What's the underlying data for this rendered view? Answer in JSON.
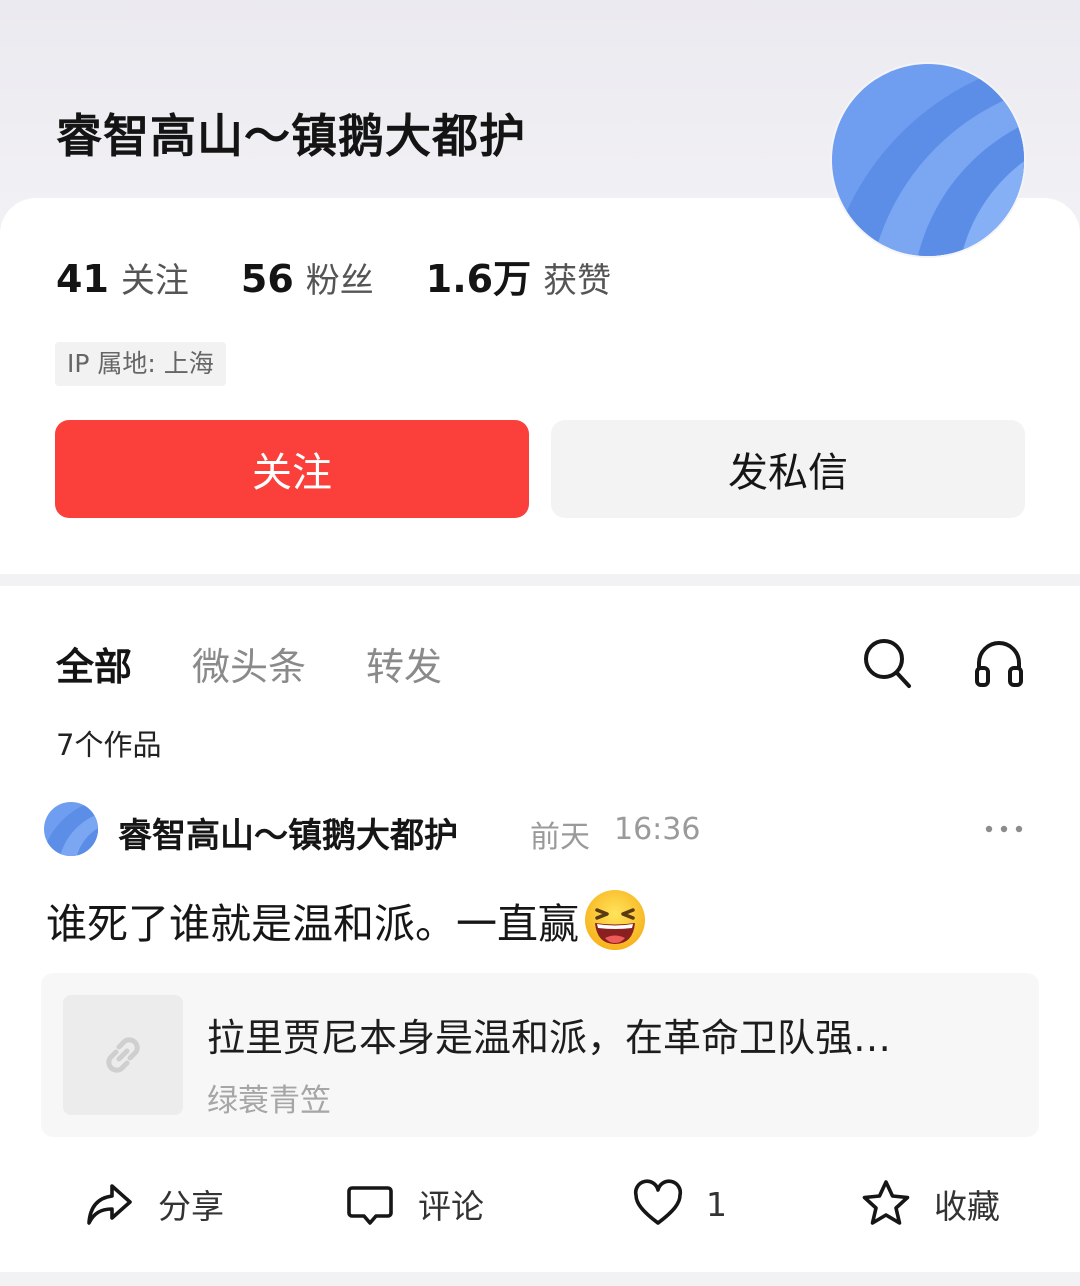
{
  "profile": {
    "name": "睿智高山～镇鹅大都护",
    "stats": [
      {
        "value": "41",
        "label": "关注"
      },
      {
        "value": "56",
        "label": "粉丝"
      },
      {
        "value": "1.6万",
        "label": "获赞"
      }
    ],
    "ip_location": "IP 属地: 上海",
    "follow_button": "关注",
    "message_button": "发私信"
  },
  "tabs": {
    "items": [
      {
        "label": "全部",
        "active": true
      },
      {
        "label": "微头条",
        "active": false
      },
      {
        "label": "转发",
        "active": false
      }
    ],
    "search_icon": "search-icon",
    "headphones_icon": "headphones-icon"
  },
  "works_count": "7个作品",
  "post": {
    "author": "睿智高山～镇鹅大都护",
    "date": "前天",
    "time": "16:36",
    "text": "谁死了谁就是温和派。一直赢",
    "emoji": "laughing-emoji",
    "link": {
      "title": "拉里贾尼本身是温和派，在革命卫队强…",
      "source": "绿蓑青笠",
      "icon": "link-icon"
    },
    "actions": {
      "share": "分享",
      "comment": "评论",
      "like_count": "1",
      "favorite": "收藏"
    }
  },
  "colors": {
    "accent": "#fb403c",
    "avatar_blue": "#5a8dec"
  }
}
